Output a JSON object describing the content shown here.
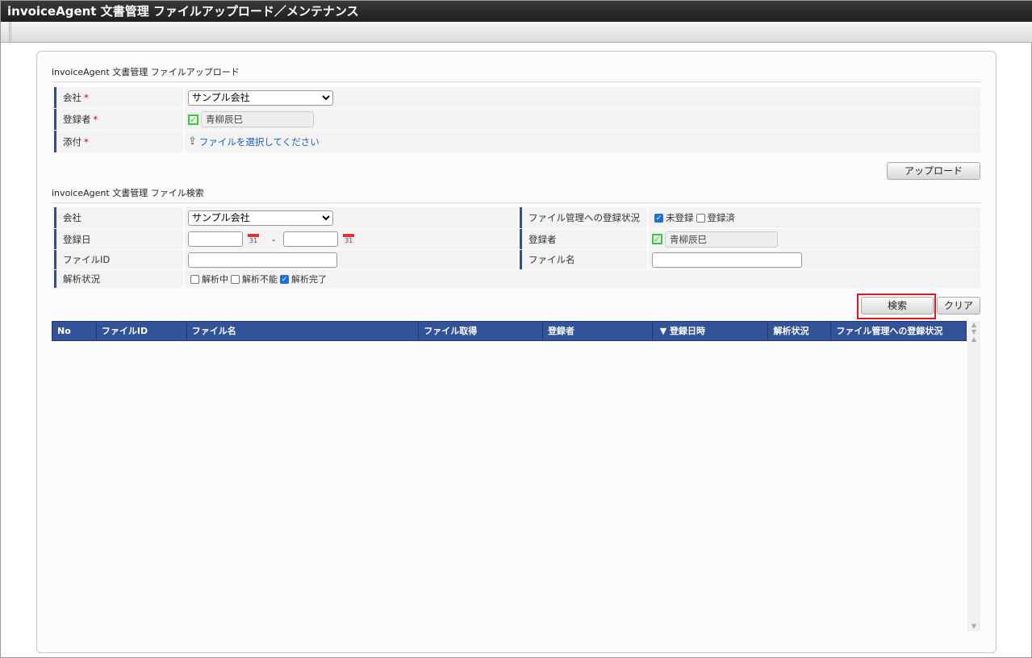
{
  "window": {
    "title": "invoiceAgent 文書管理 ファイルアップロード／メンテナンス"
  },
  "upload": {
    "heading": "invoiceAgent 文書管理 ファイルアップロード",
    "company_label": "会社",
    "company_value": "サンプル会社",
    "registrant_label": "登録者",
    "registrant_value": "青柳辰巳",
    "attach_label": "添付",
    "attach_link": "ファイルを選択してください",
    "required_mark": "*",
    "upload_button": "アップロード"
  },
  "search": {
    "heading": "invoiceAgent 文書管理 ファイル検索",
    "company_label": "会社",
    "company_value": "サンプル会社",
    "date_label": "登録日",
    "date_from": "",
    "date_to": "",
    "date_sep": "-",
    "cal_day": "31",
    "fileid_label": "ファイルID",
    "fileid_value": "",
    "analysis_label": "解析状況",
    "analysis_options": [
      {
        "label": "解析中",
        "checked": false
      },
      {
        "label": "解析不能",
        "checked": false
      },
      {
        "label": "解析完了",
        "checked": true
      }
    ],
    "regstatus_label": "ファイル管理への登録状況",
    "regstatus_options": [
      {
        "label": "未登録",
        "checked": true
      },
      {
        "label": "登録済",
        "checked": false
      }
    ],
    "registrant_label": "登録者",
    "registrant_value": "青柳辰巳",
    "filename_label": "ファイル名",
    "filename_value": "",
    "search_button": "検索",
    "clear_button": "クリア"
  },
  "grid": {
    "columns": [
      "No",
      "ファイルID",
      "ファイル名",
      "ファイル取得",
      "登録者",
      "▼ 登録日時",
      "解析状況",
      "ファイル管理への登録状況"
    ],
    "rows": []
  }
}
